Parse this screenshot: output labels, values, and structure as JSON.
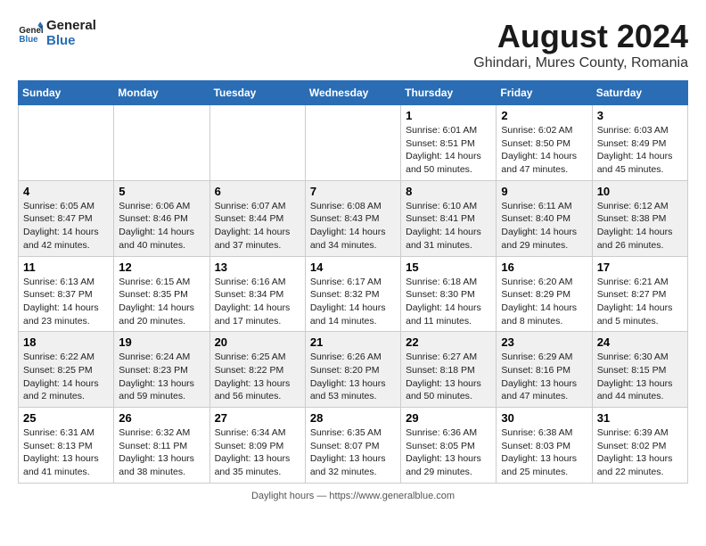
{
  "header": {
    "logo_general": "General",
    "logo_blue": "Blue",
    "month_title": "August 2024",
    "location": "Ghindari, Mures County, Romania"
  },
  "days_of_week": [
    "Sunday",
    "Monday",
    "Tuesday",
    "Wednesday",
    "Thursday",
    "Friday",
    "Saturday"
  ],
  "weeks": [
    {
      "shaded": false,
      "days": [
        {
          "date": "",
          "info": ""
        },
        {
          "date": "",
          "info": ""
        },
        {
          "date": "",
          "info": ""
        },
        {
          "date": "",
          "info": ""
        },
        {
          "date": "1",
          "info": "Sunrise: 6:01 AM\nSunset: 8:51 PM\nDaylight: 14 hours and 50 minutes."
        },
        {
          "date": "2",
          "info": "Sunrise: 6:02 AM\nSunset: 8:50 PM\nDaylight: 14 hours and 47 minutes."
        },
        {
          "date": "3",
          "info": "Sunrise: 6:03 AM\nSunset: 8:49 PM\nDaylight: 14 hours and 45 minutes."
        }
      ]
    },
    {
      "shaded": true,
      "days": [
        {
          "date": "4",
          "info": "Sunrise: 6:05 AM\nSunset: 8:47 PM\nDaylight: 14 hours and 42 minutes."
        },
        {
          "date": "5",
          "info": "Sunrise: 6:06 AM\nSunset: 8:46 PM\nDaylight: 14 hours and 40 minutes."
        },
        {
          "date": "6",
          "info": "Sunrise: 6:07 AM\nSunset: 8:44 PM\nDaylight: 14 hours and 37 minutes."
        },
        {
          "date": "7",
          "info": "Sunrise: 6:08 AM\nSunset: 8:43 PM\nDaylight: 14 hours and 34 minutes."
        },
        {
          "date": "8",
          "info": "Sunrise: 6:10 AM\nSunset: 8:41 PM\nDaylight: 14 hours and 31 minutes."
        },
        {
          "date": "9",
          "info": "Sunrise: 6:11 AM\nSunset: 8:40 PM\nDaylight: 14 hours and 29 minutes."
        },
        {
          "date": "10",
          "info": "Sunrise: 6:12 AM\nSunset: 8:38 PM\nDaylight: 14 hours and 26 minutes."
        }
      ]
    },
    {
      "shaded": false,
      "days": [
        {
          "date": "11",
          "info": "Sunrise: 6:13 AM\nSunset: 8:37 PM\nDaylight: 14 hours and 23 minutes."
        },
        {
          "date": "12",
          "info": "Sunrise: 6:15 AM\nSunset: 8:35 PM\nDaylight: 14 hours and 20 minutes."
        },
        {
          "date": "13",
          "info": "Sunrise: 6:16 AM\nSunset: 8:34 PM\nDaylight: 14 hours and 17 minutes."
        },
        {
          "date": "14",
          "info": "Sunrise: 6:17 AM\nSunset: 8:32 PM\nDaylight: 14 hours and 14 minutes."
        },
        {
          "date": "15",
          "info": "Sunrise: 6:18 AM\nSunset: 8:30 PM\nDaylight: 14 hours and 11 minutes."
        },
        {
          "date": "16",
          "info": "Sunrise: 6:20 AM\nSunset: 8:29 PM\nDaylight: 14 hours and 8 minutes."
        },
        {
          "date": "17",
          "info": "Sunrise: 6:21 AM\nSunset: 8:27 PM\nDaylight: 14 hours and 5 minutes."
        }
      ]
    },
    {
      "shaded": true,
      "days": [
        {
          "date": "18",
          "info": "Sunrise: 6:22 AM\nSunset: 8:25 PM\nDaylight: 14 hours and 2 minutes."
        },
        {
          "date": "19",
          "info": "Sunrise: 6:24 AM\nSunset: 8:23 PM\nDaylight: 13 hours and 59 minutes."
        },
        {
          "date": "20",
          "info": "Sunrise: 6:25 AM\nSunset: 8:22 PM\nDaylight: 13 hours and 56 minutes."
        },
        {
          "date": "21",
          "info": "Sunrise: 6:26 AM\nSunset: 8:20 PM\nDaylight: 13 hours and 53 minutes."
        },
        {
          "date": "22",
          "info": "Sunrise: 6:27 AM\nSunset: 8:18 PM\nDaylight: 13 hours and 50 minutes."
        },
        {
          "date": "23",
          "info": "Sunrise: 6:29 AM\nSunset: 8:16 PM\nDaylight: 13 hours and 47 minutes."
        },
        {
          "date": "24",
          "info": "Sunrise: 6:30 AM\nSunset: 8:15 PM\nDaylight: 13 hours and 44 minutes."
        }
      ]
    },
    {
      "shaded": false,
      "days": [
        {
          "date": "25",
          "info": "Sunrise: 6:31 AM\nSunset: 8:13 PM\nDaylight: 13 hours and 41 minutes."
        },
        {
          "date": "26",
          "info": "Sunrise: 6:32 AM\nSunset: 8:11 PM\nDaylight: 13 hours and 38 minutes."
        },
        {
          "date": "27",
          "info": "Sunrise: 6:34 AM\nSunset: 8:09 PM\nDaylight: 13 hours and 35 minutes."
        },
        {
          "date": "28",
          "info": "Sunrise: 6:35 AM\nSunset: 8:07 PM\nDaylight: 13 hours and 32 minutes."
        },
        {
          "date": "29",
          "info": "Sunrise: 6:36 AM\nSunset: 8:05 PM\nDaylight: 13 hours and 29 minutes."
        },
        {
          "date": "30",
          "info": "Sunrise: 6:38 AM\nSunset: 8:03 PM\nDaylight: 13 hours and 25 minutes."
        },
        {
          "date": "31",
          "info": "Sunrise: 6:39 AM\nSunset: 8:02 PM\nDaylight: 13 hours and 22 minutes."
        }
      ]
    }
  ],
  "footer": {
    "daylight_hours_label": "Daylight hours",
    "source_url": "https://www.generalblue.com"
  }
}
